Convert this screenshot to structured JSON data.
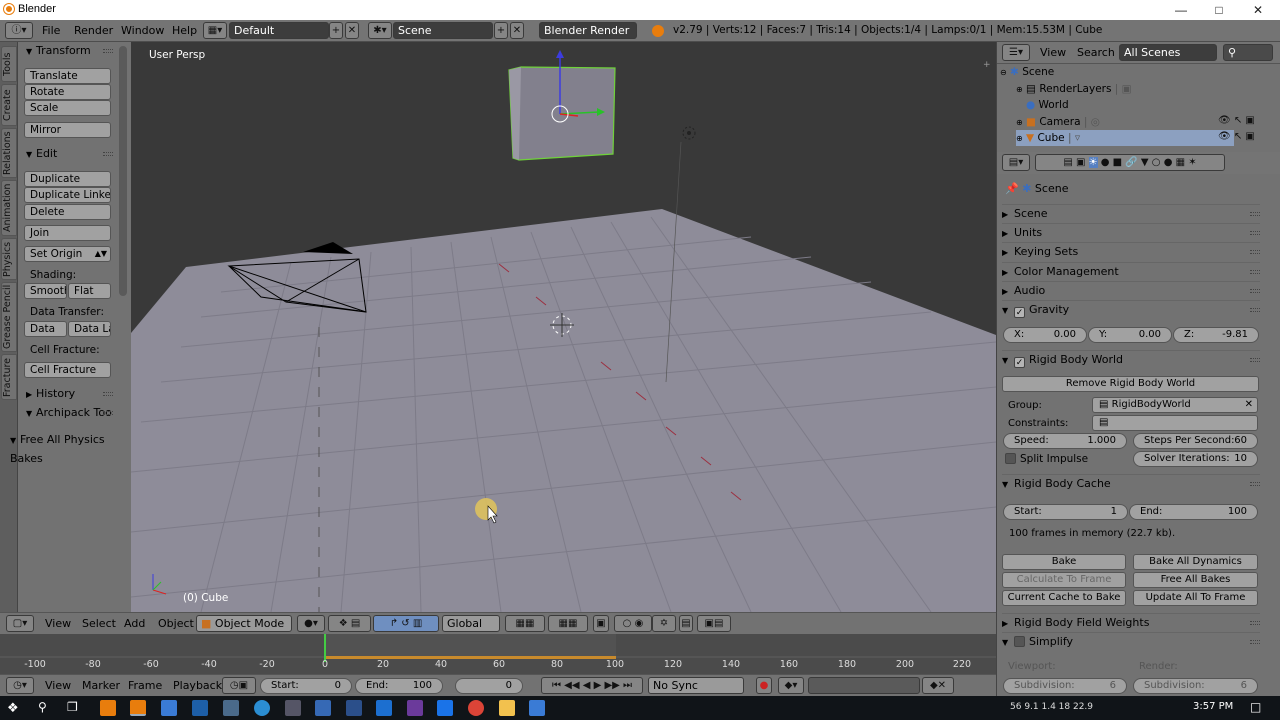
{
  "window": {
    "title": "Blender"
  },
  "topbar": {
    "menus": [
      "File",
      "Render",
      "Window",
      "Help"
    ],
    "screen_layout": "Default",
    "scene": "Scene",
    "render_engine": "Blender Render",
    "stats": "v2.79 | Verts:12 | Faces:7 | Tris:14 | Objects:1/4 | Lamps:0/1 | Mem:15.53M | Cube"
  },
  "tool_tabs": [
    "Tools",
    "Create",
    "Relations",
    "Animation",
    "Physics",
    "Grease Pencil",
    "Fracture"
  ],
  "toolshelf": {
    "transform": {
      "title": "Transform",
      "buttons": [
        "Translate",
        "Rotate",
        "Scale",
        "Mirror"
      ]
    },
    "edit": {
      "title": "Edit",
      "buttons": [
        "Duplicate",
        "Duplicate Linked",
        "Delete",
        "Join",
        "Set Origin"
      ]
    },
    "shading_label": "Shading:",
    "shading_buttons": [
      "Smooth",
      "Flat"
    ],
    "data_transfer_label": "Data Transfer:",
    "data_transfer_buttons": [
      "Data",
      "Data La"
    ],
    "cell_fracture_label": "Cell Fracture:",
    "cell_fracture_button": "Cell Fracture",
    "history": "History",
    "archipack": "Archipack Too",
    "free_bakes": "Free All Physics Bakes"
  },
  "viewport": {
    "view_name": "User Persp",
    "object_label": "(0) Cube"
  },
  "viewport_header": {
    "menus": [
      "View",
      "Select",
      "Add",
      "Object"
    ],
    "mode": "Object Mode",
    "orientation": "Global"
  },
  "timeline": {
    "ticks": [
      "-100",
      "-80",
      "-60",
      "-40",
      "-20",
      "0",
      "20",
      "40",
      "60",
      "80",
      "100",
      "120",
      "140",
      "160",
      "180",
      "200",
      "220"
    ],
    "current_frame": 0,
    "cache_start": 1,
    "cache_end": 100
  },
  "timeline_footer": {
    "menus": [
      "View",
      "Marker",
      "Frame",
      "Playback"
    ],
    "start_label": "Start:",
    "start_value": "0",
    "end_label": "End:",
    "end_value": "100",
    "frame_value": "0",
    "sync": "No Sync"
  },
  "outliner": {
    "menus": [
      "View",
      "Search"
    ],
    "filter": "All Scenes",
    "items": [
      "Scene",
      "RenderLayers",
      "World",
      "Camera",
      "Cube"
    ]
  },
  "properties": {
    "breadcrumb": "Scene",
    "sections": [
      "Scene",
      "Units",
      "Keying Sets",
      "Color Management",
      "Audio"
    ],
    "gravity": {
      "title": "Gravity",
      "x_label": "X:",
      "x": "0.00",
      "y_label": "Y:",
      "y": "0.00",
      "z_label": "Z:",
      "z": "-9.81"
    },
    "rigid_body_world": {
      "title": "Rigid Body World",
      "remove_button": "Remove Rigid Body World",
      "group_label": "Group:",
      "group_value": "RigidBodyWorld",
      "constraints_label": "Constraints:",
      "speed_label": "Speed:",
      "speed": "1.000",
      "steps_label": "Steps Per Second:",
      "steps": "60",
      "split_impulse": "Split Impulse",
      "solver_label": "Solver Iterations:",
      "solver": "10"
    },
    "cache": {
      "title": "Rigid Body Cache",
      "start_label": "Start:",
      "start": "1",
      "end_label": "End:",
      "end": "100",
      "memory": "100 frames in memory (22.7 kb).",
      "buttons": [
        "Bake",
        "Bake All Dynamics",
        "Calculate To Frame",
        "Free All Bakes",
        "Current Cache to Bake",
        "Update All To Frame"
      ]
    },
    "field_weights": "Rigid Body Field Weights",
    "simplify": {
      "title": "Simplify",
      "viewport_label": "Viewport:",
      "render_label": "Render:",
      "subdivision_label": "Subdivision:",
      "viewport_sub": "6",
      "render_sub": "6"
    }
  },
  "taskbar": {
    "tray": "56  9.1  1.4  18  22.9",
    "clock": "3:57 PM"
  },
  "colors": {
    "accent": "#e87d0d",
    "selected_blue": "#5680c2",
    "bg": "#393939",
    "panel": "#727272"
  }
}
